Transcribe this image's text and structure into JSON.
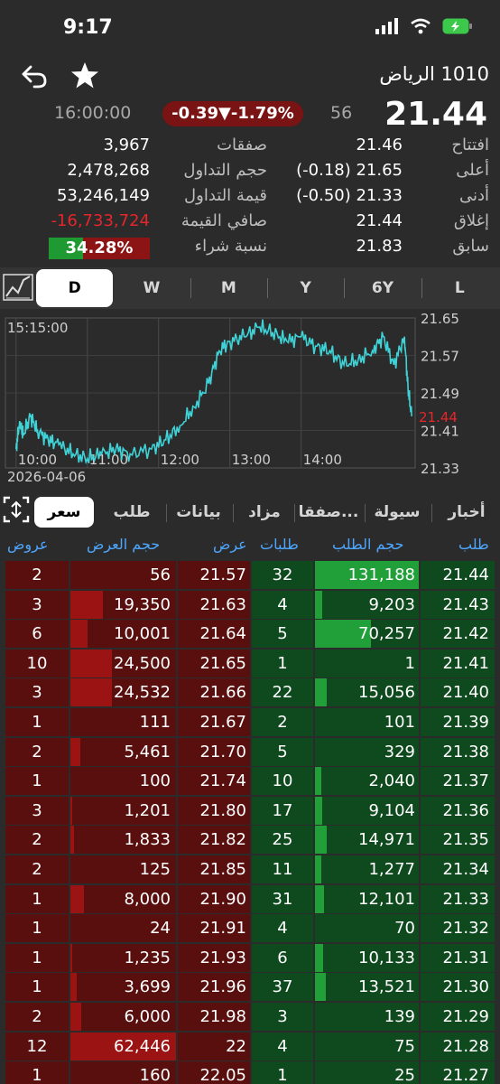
{
  "status": {
    "time": "9:17"
  },
  "header": {
    "title": "1010 الرياض"
  },
  "price": {
    "time": "16:00:00",
    "change": "-0.39▼-1.79%",
    "volume_small": "56",
    "last": "21.44"
  },
  "stats": [
    {
      "lval": "3,967",
      "llbl": "صفقات",
      "rval": "21.46",
      "rlbl": "افتتاح"
    },
    {
      "lval": "2,478,268",
      "llbl": "حجم التداول",
      "rval": "(-0.18) 21.65",
      "rlbl": "أعلى"
    },
    {
      "lval": "53,246,149",
      "llbl": "قيمة التداول",
      "rval": "(-0.50) 21.33",
      "rlbl": "أدنى"
    },
    {
      "lval": "-16,733,724",
      "llbl": "صافي القيمة",
      "rval": "21.44",
      "rlbl": "إغلاق"
    },
    {
      "lval": "34.28%",
      "llbl": "نسبة شراء",
      "rval": "21.83",
      "rlbl": "سابق"
    }
  ],
  "buy_ratio": 34.28,
  "periods": [
    "D",
    "W",
    "M",
    "Y",
    "6Y",
    "L"
  ],
  "selected_period": "D",
  "chart_data": {
    "type": "line",
    "cursor_time": "15:15:00",
    "date": "2026-04-06",
    "x_ticks": [
      "10:00",
      "11:00",
      "12:00",
      "13:00",
      "14:00"
    ],
    "y_ticks": [
      "21.65",
      "21.57",
      "21.49",
      "21.41",
      "21.33"
    ],
    "current_label": "21.44",
    "ylim": [
      21.33,
      21.65
    ],
    "series": [
      {
        "color": "#3fd3d8",
        "x": [
          10.0,
          10.05,
          10.1,
          10.2,
          10.3,
          10.45,
          10.6,
          10.8,
          11.0,
          11.2,
          11.4,
          11.6,
          11.9,
          12.1,
          12.3,
          12.5,
          12.7,
          12.85,
          13.0,
          13.2,
          13.4,
          13.6,
          13.8,
          14.0,
          14.2,
          14.4,
          14.6,
          14.8,
          15.0,
          15.15,
          15.3,
          15.45,
          15.5,
          15.55
        ],
        "y": [
          21.37,
          21.43,
          21.4,
          21.44,
          21.41,
          21.39,
          21.38,
          21.36,
          21.35,
          21.36,
          21.37,
          21.36,
          21.37,
          21.39,
          21.42,
          21.46,
          21.51,
          21.58,
          21.6,
          21.61,
          21.63,
          21.62,
          21.6,
          21.61,
          21.59,
          21.58,
          21.55,
          21.56,
          21.58,
          21.61,
          21.55,
          21.61,
          21.5,
          21.44
        ]
      }
    ]
  },
  "tabs": [
    "سعر",
    "طلب",
    "بيانات",
    "مزاد",
    "صفقا...",
    "سيولة",
    "أخبار"
  ],
  "selected_tab": "سعر",
  "columns": [
    "عروض",
    "حجم العرض",
    "عرض",
    "طلبات",
    "حجم الطلب",
    "طلب"
  ],
  "order_book": [
    {
      "asks": "2",
      "ask_qty": "56",
      "ask": "21.57",
      "bids": "32",
      "bid_qty": "131,188",
      "bid": "21.44",
      "ask_frac": 0.0,
      "bid_frac": 1.0
    },
    {
      "asks": "3",
      "ask_qty": "19,350",
      "ask": "21.63",
      "bids": "4",
      "bid_qty": "9,203",
      "bid": "21.43",
      "ask_frac": 0.31,
      "bid_frac": 0.07
    },
    {
      "asks": "6",
      "ask_qty": "10,001",
      "ask": "21.64",
      "bids": "5",
      "bid_qty": "70,257",
      "bid": "21.42",
      "ask_frac": 0.16,
      "bid_frac": 0.54
    },
    {
      "asks": "10",
      "ask_qty": "24,500",
      "ask": "21.65",
      "bids": "1",
      "bid_qty": "1",
      "bid": "21.41",
      "ask_frac": 0.39,
      "bid_frac": 0.0
    },
    {
      "asks": "3",
      "ask_qty": "24,532",
      "ask": "21.66",
      "bids": "22",
      "bid_qty": "15,056",
      "bid": "21.40",
      "ask_frac": 0.39,
      "bid_frac": 0.11
    },
    {
      "asks": "1",
      "ask_qty": "111",
      "ask": "21.67",
      "bids": "2",
      "bid_qty": "101",
      "bid": "21.39",
      "ask_frac": 0.0,
      "bid_frac": 0.0
    },
    {
      "asks": "2",
      "ask_qty": "5,461",
      "ask": "21.70",
      "bids": "5",
      "bid_qty": "329",
      "bid": "21.38",
      "ask_frac": 0.09,
      "bid_frac": 0.0
    },
    {
      "asks": "1",
      "ask_qty": "100",
      "ask": "21.74",
      "bids": "10",
      "bid_qty": "2,040",
      "bid": "21.37",
      "ask_frac": 0.0,
      "bid_frac": 0.02
    },
    {
      "asks": "3",
      "ask_qty": "1,201",
      "ask": "21.80",
      "bids": "17",
      "bid_qty": "9,104",
      "bid": "21.36",
      "ask_frac": 0.02,
      "bid_frac": 0.07
    },
    {
      "asks": "2",
      "ask_qty": "1,833",
      "ask": "21.82",
      "bids": "25",
      "bid_qty": "14,971",
      "bid": "21.35",
      "ask_frac": 0.03,
      "bid_frac": 0.11
    },
    {
      "asks": "2",
      "ask_qty": "125",
      "ask": "21.85",
      "bids": "11",
      "bid_qty": "1,277",
      "bid": "21.34",
      "ask_frac": 0.0,
      "bid_frac": 0.01
    },
    {
      "asks": "1",
      "ask_qty": "8,000",
      "ask": "21.90",
      "bids": "31",
      "bid_qty": "12,101",
      "bid": "21.33",
      "ask_frac": 0.13,
      "bid_frac": 0.09
    },
    {
      "asks": "1",
      "ask_qty": "24",
      "ask": "21.91",
      "bids": "4",
      "bid_qty": "70",
      "bid": "21.32",
      "ask_frac": 0.0,
      "bid_frac": 0.0
    },
    {
      "asks": "1",
      "ask_qty": "1,235",
      "ask": "21.93",
      "bids": "6",
      "bid_qty": "10,133",
      "bid": "21.31",
      "ask_frac": 0.02,
      "bid_frac": 0.08
    },
    {
      "asks": "1",
      "ask_qty": "3,699",
      "ask": "21.96",
      "bids": "37",
      "bid_qty": "13,521",
      "bid": "21.30",
      "ask_frac": 0.06,
      "bid_frac": 0.1
    },
    {
      "asks": "2",
      "ask_qty": "6,000",
      "ask": "21.98",
      "bids": "3",
      "bid_qty": "139",
      "bid": "21.29",
      "ask_frac": 0.1,
      "bid_frac": 0.0
    },
    {
      "asks": "12",
      "ask_qty": "62,446",
      "ask": "22",
      "bids": "4",
      "bid_qty": "75",
      "bid": "21.28",
      "ask_frac": 1.0,
      "bid_frac": 0.0
    },
    {
      "asks": "1",
      "ask_qty": "160",
      "ask": "22.05",
      "bids": "1",
      "bid_qty": "25",
      "bid": "21.27",
      "ask_frac": 0.0,
      "bid_frac": 0.0
    }
  ],
  "colors": {
    "up": "#1f9a32",
    "down": "#e5262b",
    "accent": "#4ea7ff",
    "line": "#3fd3d8"
  }
}
